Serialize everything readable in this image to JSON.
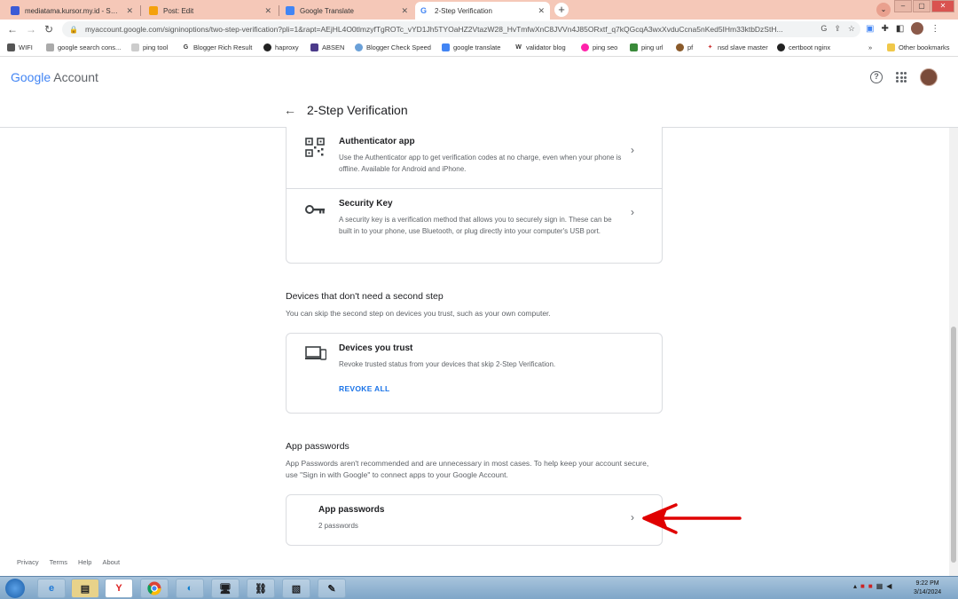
{
  "browser": {
    "tabs": [
      {
        "title": "mediatama.kursor.my.id - Servic",
        "active": false
      },
      {
        "title": "Post: Edit",
        "active": false
      },
      {
        "title": "Google Translate",
        "active": false
      },
      {
        "title": "2-Step Verification",
        "active": true
      }
    ],
    "url": "myaccount.google.com/signinoptions/two-step-verification?pli=1&rapt=AEjHL4O0tlmzyfTgROTc_vYD1Jh5TYOaHZ2VtazW28_HvTmfwXnC8JVVn4J85ORxtf_q7kQGcqA3wxXvduCcna5nKed5IHm33ktbDzStH...",
    "bookmarks": [
      "WIFI",
      "google search cons...",
      "ping tool",
      "Blogger Rich Result",
      "haproxy",
      "ABSEN",
      "Blogger Check Speed",
      "google translate",
      "validator blog",
      "ping seo",
      "ping url",
      "pf",
      "nsd slave master",
      "certboot nginx",
      "Other bookmarks"
    ]
  },
  "header": {
    "logo_google": "Google",
    "logo_account": "Account",
    "page_title": "2-Step Verification"
  },
  "second_steps": [
    {
      "title": "Authenticator app",
      "description": "Use the Authenticator app to get verification codes at no charge, even when your phone is offline. Available for Android and iPhone.",
      "icon": "qr-code-icon"
    },
    {
      "title": "Security Key",
      "description": "A security key is a verification method that allows you to securely sign in. These can be built in to your phone, use Bluetooth, or plug directly into your computer's USB port.",
      "icon": "key-icon"
    }
  ],
  "devices_section": {
    "title": "Devices that don't need a second step",
    "description": "You can skip the second step on devices you trust, such as your own computer.",
    "card_title": "Devices you trust",
    "card_description": "Revoke trusted status from your devices that skip 2-Step Verification.",
    "revoke_label": "REVOKE ALL"
  },
  "app_passwords_section": {
    "title": "App passwords",
    "description": "App Passwords aren't recommended and are unnecessary in most cases. To help keep your account secure, use \"Sign in with Google\" to connect apps to your Google Account.",
    "card_title": "App passwords",
    "card_subtitle": "2 passwords"
  },
  "footer": {
    "links": [
      "Privacy",
      "Terms",
      "Help",
      "About"
    ]
  },
  "taskbar": {
    "time": "9:22 PM",
    "date": "3/14/2024"
  },
  "colors": {
    "accent": "#1a73e8",
    "annotation_arrow": "#e00000",
    "tab_strip": "#f5c8b8"
  }
}
